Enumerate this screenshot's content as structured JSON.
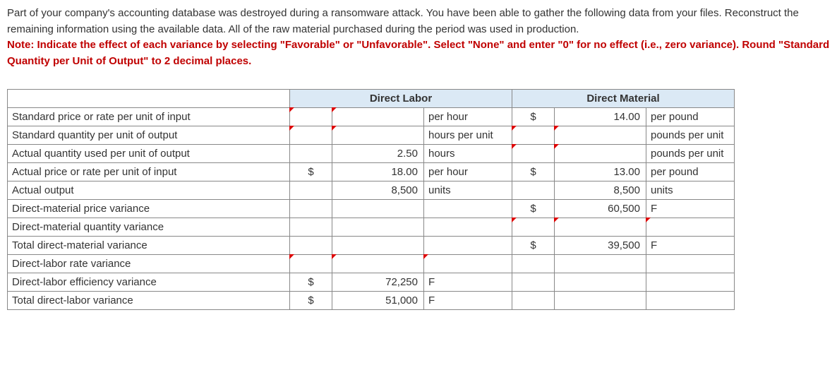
{
  "instructions": {
    "line1": "Part of your company's accounting database was destroyed during a ransomware attack. You have been able to gather the following data from your files. Reconstruct the remaining information using the available data. All of the raw material purchased during the period was used in production.",
    "note": "Note: Indicate the effect of each variance by selecting \"Favorable\" or \"Unfavorable\". Select \"None\" and enter \"0\" for no effect (i.e., zero variance). Round \"Standard Quantity per Unit of Output\" to 2 decimal places."
  },
  "headers": {
    "dl": "Direct Labor",
    "dm": "Direct Material"
  },
  "rows": {
    "r1": {
      "label": "Standard price or rate per unit of input",
      "dl_cur": "",
      "dl_val": "",
      "dl_unit": "per hour",
      "dm_cur": "$",
      "dm_val": "14.00",
      "dm_unit": "per pound"
    },
    "r2": {
      "label": "Standard quantity per unit of output",
      "dl_cur": "",
      "dl_val": "",
      "dl_unit": "hours per unit",
      "dm_cur": "",
      "dm_val": "",
      "dm_unit": "pounds per unit"
    },
    "r3": {
      "label": "Actual quantity used per unit of output",
      "dl_cur": "",
      "dl_val": "2.50",
      "dl_unit": "hours",
      "dm_cur": "",
      "dm_val": "",
      "dm_unit": "pounds per unit"
    },
    "r4": {
      "label": "Actual price or rate per unit of input",
      "dl_cur": "$",
      "dl_val": "18.00",
      "dl_unit": "per hour",
      "dm_cur": "$",
      "dm_val": "13.00",
      "dm_unit": "per pound"
    },
    "r5": {
      "label": "Actual output",
      "dl_cur": "",
      "dl_val": "8,500",
      "dl_unit": "units",
      "dm_cur": "",
      "dm_val": "8,500",
      "dm_unit": "units"
    },
    "r6": {
      "label": "Direct-material price variance",
      "dl_cur": "",
      "dl_val": "",
      "dl_unit": "",
      "dm_cur": "$",
      "dm_val": "60,500",
      "dm_unit": "F"
    },
    "r7": {
      "label": "Direct-material quantity variance",
      "dl_cur": "",
      "dl_val": "",
      "dl_unit": "",
      "dm_cur": "",
      "dm_val": "",
      "dm_unit": ""
    },
    "r8": {
      "label": "Total direct-material variance",
      "dl_cur": "",
      "dl_val": "",
      "dl_unit": "",
      "dm_cur": "$",
      "dm_val": "39,500",
      "dm_unit": "F"
    },
    "r9": {
      "label": "Direct-labor rate variance",
      "dl_cur": "",
      "dl_val": "",
      "dl_unit": "",
      "dm_cur": "",
      "dm_val": "",
      "dm_unit": ""
    },
    "r10": {
      "label": "Direct-labor efficiency variance",
      "dl_cur": "$",
      "dl_val": "72,250",
      "dl_unit": "F",
      "dm_cur": "",
      "dm_val": "",
      "dm_unit": ""
    },
    "r11": {
      "label": "Total direct-labor variance",
      "dl_cur": "$",
      "dl_val": "51,000",
      "dl_unit": "F",
      "dm_cur": "",
      "dm_val": "",
      "dm_unit": ""
    }
  }
}
